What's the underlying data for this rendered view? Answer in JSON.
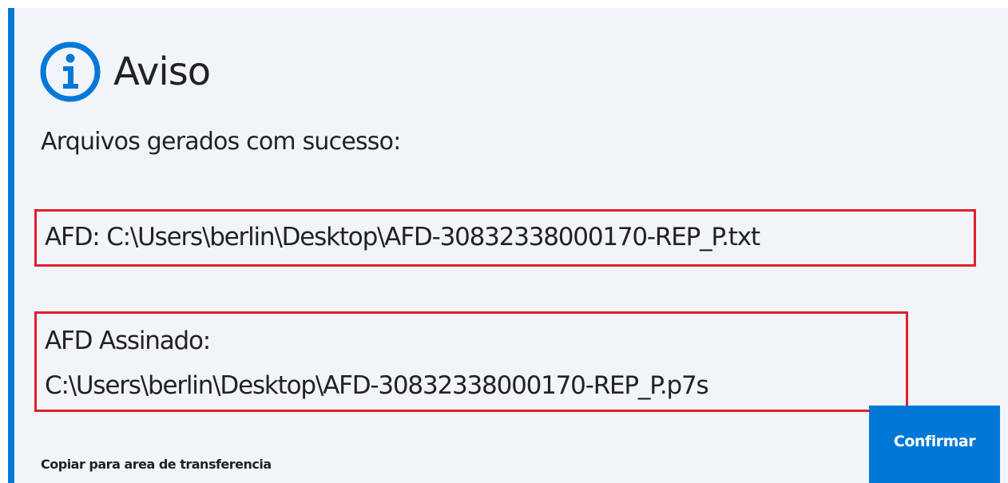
{
  "dialog": {
    "title": "Aviso",
    "icon": "info-icon",
    "message": "Arquivos gerados com sucesso:",
    "afd_line": "AFD: C:\\Users\\berlin\\Desktop\\AFD-30832338000170-REP_P.txt",
    "signed_label": "AFD Assinado:",
    "signed_path": "C:\\Users\\berlin\\Desktop\\AFD-30832338000170-REP_P.p7s",
    "copy_label": "Copiar para area de transferencia",
    "confirm_label": "Confirmar"
  },
  "colors": {
    "accent": "#0078d7",
    "highlight_border": "#e0202c",
    "background": "#f1f4f9"
  }
}
